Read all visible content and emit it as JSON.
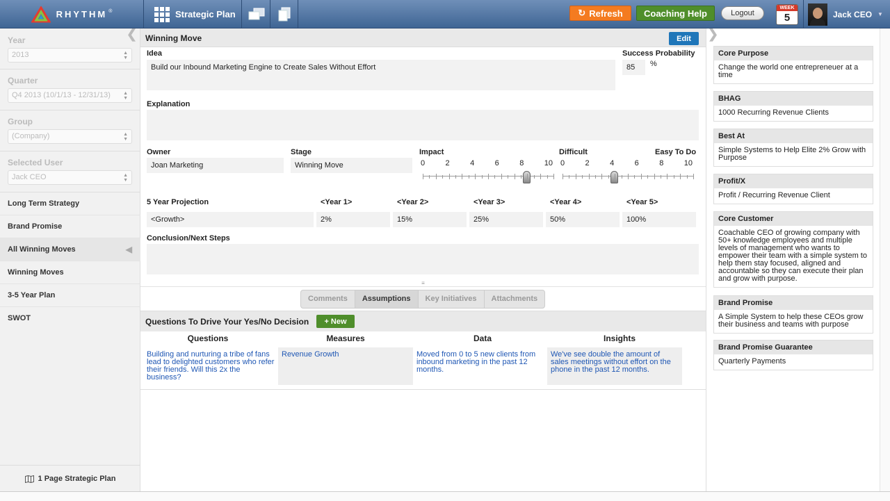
{
  "header": {
    "logo_text": "RHYTHM",
    "logo_reg": "®",
    "plan_label": "Strategic Plan",
    "refresh_label": "Refresh",
    "coaching_label": "Coaching Help",
    "logout_label": "Logout",
    "week_label": "WEEK",
    "week_number": "5",
    "user_name": "Jack CEO"
  },
  "sidebar": {
    "year_label": "Year",
    "year_value": "2013",
    "quarter_label": "Quarter",
    "quarter_value": "Q4 2013 (10/1/13 - 12/31/13)",
    "group_label": "Group",
    "group_value": "(Company)",
    "user_label": "Selected User",
    "user_value": "Jack CEO",
    "nav": [
      {
        "label": "Long Term Strategy"
      },
      {
        "label": "Brand Promise"
      },
      {
        "label": "All Winning Moves"
      },
      {
        "label": "Winning Moves"
      },
      {
        "label": "3-5 Year Plan"
      },
      {
        "label": "SWOT"
      }
    ],
    "footer_label": "1 Page Strategic Plan"
  },
  "main": {
    "title": "Winning Move",
    "edit_label": "Edit",
    "idea_label": "Idea",
    "idea_value": "Build our Inbound Marketing Engine to Create Sales Without Effort",
    "success_label": "Success Probability",
    "success_value": "85",
    "success_unit": "%",
    "explanation_label": "Explanation",
    "explanation_value": "",
    "owner_label": "Owner",
    "owner_value": "Joan Marketing",
    "stage_label": "Stage",
    "stage_value": "Winning Move",
    "impact_label": "Impact",
    "impact_value": 8,
    "difficult_label": "Difficult",
    "easy_label": "Easy To Do",
    "difficulty_value": 4,
    "scale_ticks": [
      "0",
      "2",
      "4",
      "6",
      "8",
      "10"
    ],
    "projection": {
      "label": "5 Year Projection",
      "years": [
        "<Year 1>",
        "<Year 2>",
        "<Year 3>",
        "<Year 4>",
        "<Year 5>"
      ],
      "row_label": "<Growth>",
      "values": [
        "2%",
        "15%",
        "25%",
        "50%",
        "100%"
      ]
    },
    "conclusion_label": "Conclusion/Next Steps",
    "conclusion_value": "",
    "tabs": [
      {
        "label": "Comments"
      },
      {
        "label": "Assumptions"
      },
      {
        "label": "Key Initiatives"
      },
      {
        "label": "Attachments"
      }
    ],
    "questions_title": "Questions To Drive Your Yes/No Decision",
    "new_label": "+ New",
    "columns": [
      "Questions",
      "Measures",
      "Data",
      "Insights"
    ],
    "row": [
      "Building and nurturing a tribe of fans lead to delighted customers who refer their friends. Will this 2x the business?",
      "Revenue Growth",
      "Moved from 0 to 5 new clients from inbound marketing in the past 12 months.",
      "We've see double the amount of sales meetings without effort on the phone in the past 12 months."
    ]
  },
  "right_panel": {
    "cards": [
      {
        "title": "Core Purpose",
        "body": "Change the world one entrepreneuer at a time"
      },
      {
        "title": "BHAG",
        "body": "1000 Recurring Revenue Clients"
      },
      {
        "title": "Best At",
        "body": "Simple Systems to Help Elite 2% Grow with Purpose"
      },
      {
        "title": "Profit/X",
        "body": "Profit / Recurring Revenue Client"
      },
      {
        "title": "Core Customer",
        "body": "Coachable CEO of growing company with 50+ knowledge employees and multiple levels of management who wants to empower their team with a simple system to help them stay focused, aligned and accountable so they can execute their plan and grow with purpose."
      },
      {
        "title": "Brand Promise",
        "body": "A Simple System to help these CEOs grow their business and teams with purpose"
      },
      {
        "title": "Brand Promise Guarantee",
        "body": "Quarterly Payments"
      }
    ]
  },
  "colors": {
    "topbar": "#4f74a3",
    "refresh": "#f47b20",
    "coaching": "#4f8e2b",
    "edit": "#1f76b9",
    "link_text": "#1f57b4"
  }
}
